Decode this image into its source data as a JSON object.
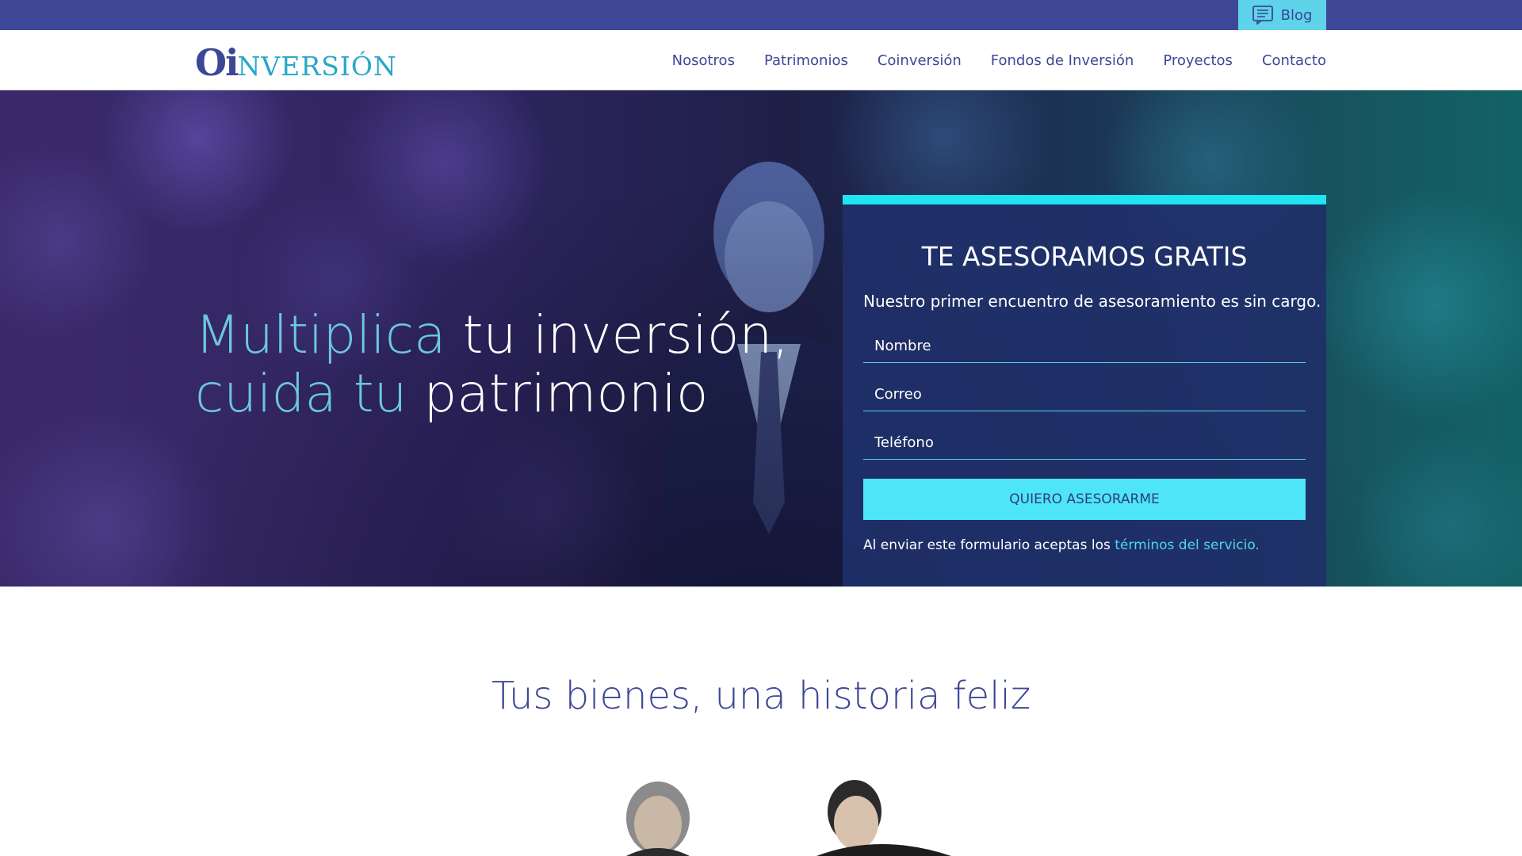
{
  "topbar": {
    "blog_label": "Blog",
    "blog_icon": "document-icon"
  },
  "header": {
    "logo": {
      "oi": "Oi",
      "rest": "NVERSIÓN"
    },
    "nav": [
      "Nosotros",
      "Patrimonios",
      "Coinversión",
      "Fondos de Inversión",
      "Proyectos",
      "Contacto"
    ]
  },
  "hero": {
    "headline_line1_highlight": "Multiplica",
    "headline_line1_rest": " tu inversión,",
    "headline_line2_highlight": "cuida tu",
    "headline_line2_rest": " patrimonio"
  },
  "form": {
    "title": "TE ASESORAMOS GRATIS",
    "subtitle": "Nuestro primer encuentro de asesoramiento es sin cargo.",
    "fields": [
      "Nombre",
      "Correo",
      "Teléfono"
    ],
    "submit_label": "QUIERO ASESORARME",
    "terms_prefix": "Al enviar este formulario aceptas los ",
    "terms_link": "términos del servicio."
  },
  "section": {
    "title": "Tus bienes, una historia feliz"
  },
  "colors": {
    "brand": "#3d4796",
    "accent": "#1fe4f2",
    "button": "#4fe5f8",
    "highlight": "#6cc8dc"
  }
}
